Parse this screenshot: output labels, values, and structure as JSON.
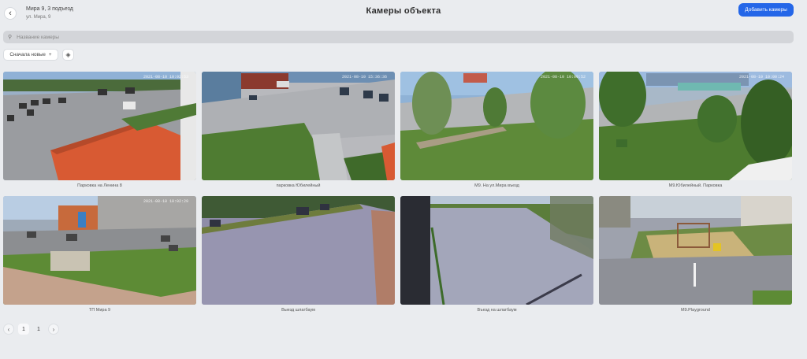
{
  "header": {
    "address_line1": "Мира 9, 3 подъезд",
    "address_line2": "ул. Мира, 9",
    "title": "Камеры объекта",
    "add_button": "Добавить камеры",
    "back_icon": "arrow-left-icon"
  },
  "search": {
    "placeholder": "Название камеры",
    "icon": "search-icon"
  },
  "toolbar": {
    "sort_label": "Сначала новые",
    "sort_icon": "plus-icon",
    "view_icon": "layers-icon"
  },
  "cameras": [
    {
      "label": "Парковка на Ленина 8",
      "timestamp": "2021-08-10 10:02:53"
    },
    {
      "label": "парковка Юбилейный",
      "timestamp": "2021-08-10 15:36:36"
    },
    {
      "label": "М9. На ул.Мира въезд",
      "timestamp": "2021-08-10 10:00:52"
    },
    {
      "label": "М9.Юбилейный. Парковка",
      "timestamp": "2021-08-10 10:00:24"
    },
    {
      "label": "ТП Мира 9",
      "timestamp": "2021-08-10 10:02:29"
    },
    {
      "label": "Выезд шлагбаум",
      "timestamp": ""
    },
    {
      "label": "Въезд на шлагбаум",
      "timestamp": ""
    },
    {
      "label": "M9.Playground",
      "timestamp": ""
    }
  ],
  "pagination": {
    "prev_icon": "chevron-left-icon",
    "next_icon": "chevron-right-icon",
    "pages": [
      "1",
      "1"
    ]
  },
  "colors": {
    "accent": "#2466e8",
    "background": "#eaecef"
  }
}
